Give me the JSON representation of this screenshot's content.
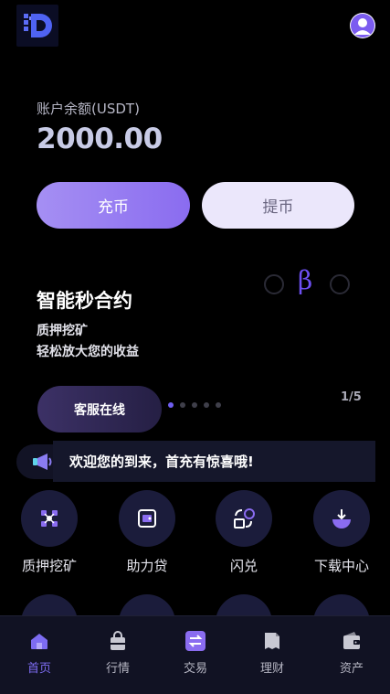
{
  "header": {
    "logo_icon": "d-logo-icon",
    "avatar_icon": "user-avatar-icon"
  },
  "balance": {
    "label": "账户余额(USDT)",
    "value": "2000.00"
  },
  "actions": {
    "deposit_label": "充币",
    "withdraw_label": "提币"
  },
  "banner": {
    "title": "智能秒合约",
    "subtitle_line1": "质押挖矿",
    "subtitle_line2": "轻松放大您的收益",
    "beta_symbol": "β",
    "service_label": "客服在线",
    "pager": "1/5"
  },
  "notice": {
    "icon": "megaphone-icon",
    "text": "欢迎您的到来，首充有惊喜哦!"
  },
  "menu": [
    {
      "label": "质押挖矿",
      "icon": "staking-mining-icon"
    },
    {
      "label": "助力贷",
      "icon": "loan-icon"
    },
    {
      "label": "闪兑",
      "icon": "swap-icon"
    },
    {
      "label": "下载中心",
      "icon": "download-icon"
    }
  ],
  "tabs": [
    {
      "label": "首页",
      "icon": "home-icon",
      "active": true
    },
    {
      "label": "行情",
      "icon": "market-icon",
      "active": false
    },
    {
      "label": "交易",
      "icon": "trade-icon",
      "active": false
    },
    {
      "label": "理财",
      "icon": "finance-icon",
      "active": false
    },
    {
      "label": "资产",
      "icon": "wallet-icon",
      "active": false
    }
  ],
  "colors": {
    "accent": "#7d6cf1",
    "deposit_gradient_start": "#a58ff3",
    "deposit_gradient_end": "#8a6cf0",
    "background": "#000000"
  }
}
